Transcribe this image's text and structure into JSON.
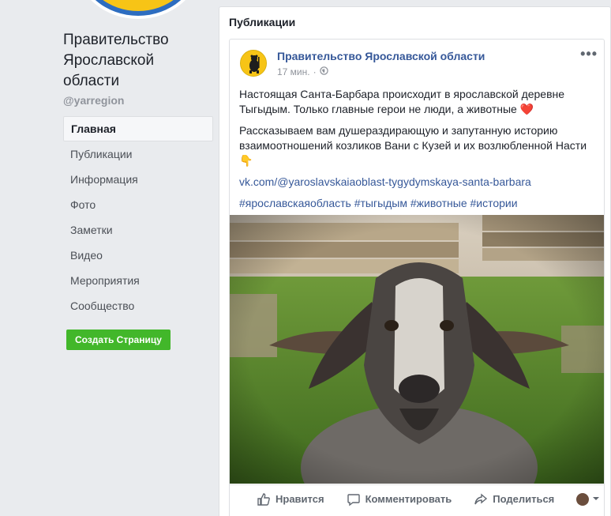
{
  "page": {
    "name": "Правительство Ярославской области",
    "name_lines": [
      "Правительство",
      "Ярославской",
      "области"
    ],
    "handle": "@yarregion"
  },
  "nav": {
    "items": [
      {
        "label": "Главная",
        "active": true
      },
      {
        "label": "Публикации"
      },
      {
        "label": "Информация"
      },
      {
        "label": "Фото"
      },
      {
        "label": "Заметки"
      },
      {
        "label": "Видео"
      },
      {
        "label": "Мероприятия"
      },
      {
        "label": "Сообщество"
      }
    ],
    "create_button": "Создать Страницу"
  },
  "feed": {
    "title": "Публикации"
  },
  "post": {
    "author": "Правительство Ярославской области",
    "time": "17 мин.",
    "separator": "·",
    "more": "•••",
    "paragraph1": "Настоящая Санта-Барбара происходит в ярославской деревне Тыгыдым. Только главные герои не люди, а животные",
    "heart": "❤️",
    "paragraph2": "Рассказываем вам душераздирающую и запутанную историю взаимоотношений козликов Вани с Кузей и их возлюбленной Насти",
    "finger": "👇",
    "link": "vk.com/@yaroslavskaiaoblast-tygydymskaya-santa-barbara",
    "hashtags": "#ярославскаяобласть #тыгыдым #животные #истории"
  },
  "actions": {
    "like": "Нравится",
    "comment": "Комментировать",
    "share": "Поделиться"
  },
  "colors": {
    "link_blue": "#365899",
    "brand_green": "#42b72a",
    "background": "#e9ebee",
    "emblem_yellow": "#f7c416"
  }
}
